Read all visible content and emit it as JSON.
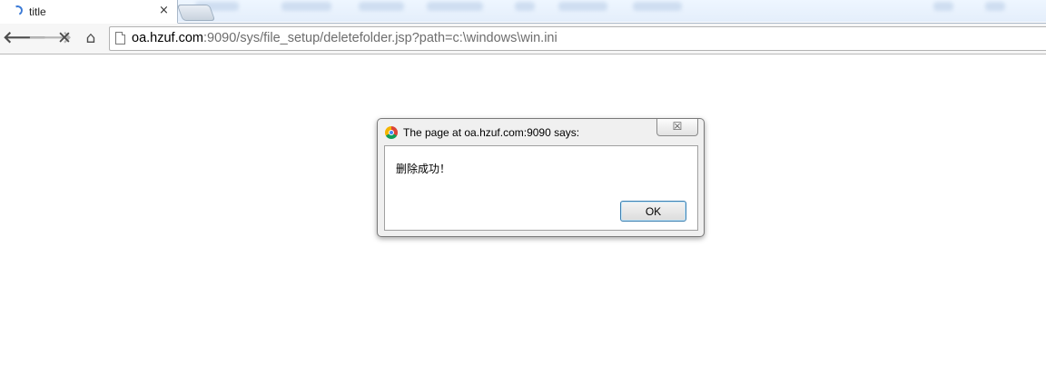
{
  "tab": {
    "title": "title",
    "close_glyph": "×",
    "loading_icon": "loading-spinner-icon"
  },
  "toolbar": {
    "back_glyph": "🡐",
    "forward_glyph": "🡒",
    "stop_glyph": "✕",
    "home_glyph": "⌂",
    "url_host": "oa.hzuf.com",
    "url_rest": ":9090/sys/file_setup/deletefolder.jsp?path=c:\\windows\\win.ini"
  },
  "dialog": {
    "title": "The page at oa.hzuf.com:9090 says:",
    "message": "删除成功！",
    "ok_label": "OK",
    "close_glyph": "☒"
  },
  "colors": {
    "accent_blue": "#3c7fb1",
    "toolbar_bg": "#f6f6f6",
    "dialog_bg": "#f0f0f0"
  }
}
